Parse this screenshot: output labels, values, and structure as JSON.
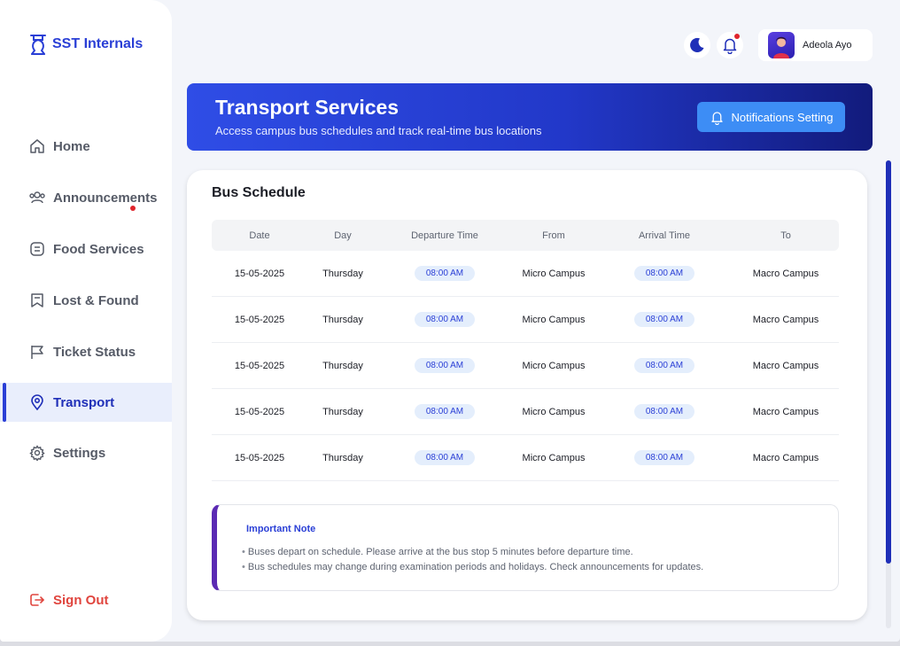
{
  "app": {
    "name": "SST Internals"
  },
  "sidebar": {
    "items": [
      {
        "label": "Home"
      },
      {
        "label": "Announcements"
      },
      {
        "label": "Food Services"
      },
      {
        "label": "Lost & Found"
      },
      {
        "label": "Ticket Status"
      },
      {
        "label": "Transport"
      },
      {
        "label": "Settings"
      }
    ],
    "active": "Transport",
    "signout_label": "Sign Out"
  },
  "header": {
    "user_name": "Adeola Ayo",
    "icons": [
      "moon-icon",
      "bell-icon"
    ]
  },
  "banner": {
    "title": "Transport Services",
    "subtitle": "Access campus bus schedules and track real-time bus locations",
    "button_label": "Notifications Setting"
  },
  "schedule": {
    "title": "Bus Schedule",
    "columns": [
      "Date",
      "Day",
      "Departure Time",
      "From",
      "Arrival Time",
      "To"
    ],
    "rows": [
      {
        "date": "15-05-2025",
        "day": "Thursday",
        "departure": "08:00 AM",
        "from": "Micro Campus",
        "arrival": "08:00 AM",
        "to": "Macro Campus"
      },
      {
        "date": "15-05-2025",
        "day": "Thursday",
        "departure": "08:00 AM",
        "from": "Micro Campus",
        "arrival": "08:00 AM",
        "to": "Macro Campus"
      },
      {
        "date": "15-05-2025",
        "day": "Thursday",
        "departure": "08:00 AM",
        "from": "Micro Campus",
        "arrival": "08:00 AM",
        "to": "Macro Campus"
      },
      {
        "date": "15-05-2025",
        "day": "Thursday",
        "departure": "08:00 AM",
        "from": "Micro Campus",
        "arrival": "08:00 AM",
        "to": "Macro Campus"
      },
      {
        "date": "15-05-2025",
        "day": "Thursday",
        "departure": "08:00 AM",
        "from": "Micro Campus",
        "arrival": "08:00 AM",
        "to": "Macro Campus"
      }
    ]
  },
  "note": {
    "title": "Important Note",
    "items": [
      "Buses depart on schedule. Please arrive at the bus stop 5 minutes before departure time.",
      "Bus schedules may change during examination periods and holidays. Check announcements for updates."
    ]
  },
  "colors": {
    "brand": "#2a3fd6",
    "signout": "#e0453e",
    "notification_dot": "#e0242c",
    "note_accent": "#5b2ab3"
  }
}
